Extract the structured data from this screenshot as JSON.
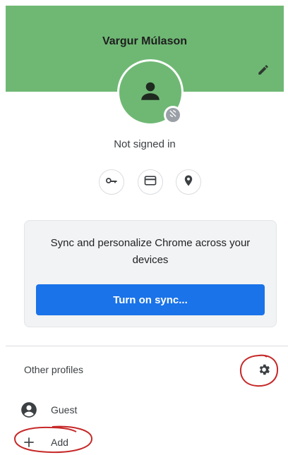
{
  "header": {
    "profile_name": "Vargur Múlason",
    "band_color": "#6fb874",
    "edit_icon": "pencil-icon"
  },
  "avatar": {
    "icon": "person-icon",
    "badge_icon": "sync-off-icon"
  },
  "status": {
    "text": "Not signed in"
  },
  "quick_actions": [
    {
      "icon": "key-icon",
      "label": "Passwords"
    },
    {
      "icon": "credit-card-icon",
      "label": "Payment methods"
    },
    {
      "icon": "location-pin-icon",
      "label": "Addresses"
    }
  ],
  "sync_card": {
    "text": "Sync and personalize Chrome across your devices",
    "button_label": "Turn on sync...",
    "button_color": "#1a73e8"
  },
  "other_profiles": {
    "label": "Other profiles",
    "settings_icon": "gear-icon",
    "items": [
      {
        "icon": "account-circle-icon",
        "label": "Guest"
      },
      {
        "icon": "plus-icon",
        "label": "Add"
      }
    ]
  },
  "annotations": {
    "color": "#c62828"
  }
}
